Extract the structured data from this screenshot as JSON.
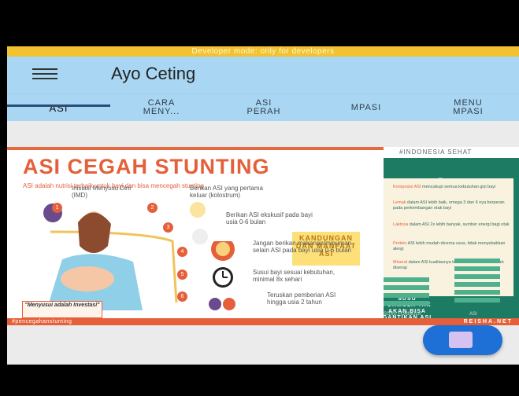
{
  "dev_banner": "Developer mode: only for developers",
  "app": {
    "title": "Ayo Ceting",
    "menu_icon": "hamburger-icon"
  },
  "tabs": [
    {
      "label": "ASI",
      "active": true
    },
    {
      "label": "CARA MENY...",
      "active": false
    },
    {
      "label": "ASI PERAH",
      "active": false
    },
    {
      "label": "MPASI",
      "active": false
    },
    {
      "label": "MENU MPASI",
      "active": false
    }
  ],
  "poster": {
    "headline": "ASI CEGAH STUNTING",
    "subhead": "ASI adalah nutrisi terbaik untuk bayi dan bisa mencegah stunting",
    "hashtag_top": "#INDONESIA SEHAT",
    "kandungan": "KANDUNGAN DAN MANFAAT ASI",
    "steps": [
      "Inisiasi Menyusu Dini (IMD)",
      "Berikan ASI yang pertama keluar (kolostrum)",
      "Berikan ASI ekskusif pada bayi usia 0-6 bulan",
      "Jangan berikan makanan/minuman selain ASI pada bayi usia 0-6 bulan",
      "Susui bayi sesuai kebutuhan, minimal 8x sehari",
      "Teruskan pemberian ASI hingga usia 2 tahun"
    ],
    "tips": [
      {
        "key": "Komposisi ASI",
        "text": " mencukupi semua kebutuhan gizi bayi"
      },
      {
        "key": "Lemak",
        "text": " dalam ASI lebih baik, omega 3 dan 6 nya berperan pada perkembangan otak bayi"
      },
      {
        "key": "Laktosa",
        "text": " dalam ASI 2x lebih banyak, sumber energi bagi otak"
      },
      {
        "key": "Protein",
        "text": " ASI lebih mudah dicerna usus, tidak menyebabkan alergi"
      },
      {
        "key": "Mineral",
        "text": " dalam ASI kualitasnya lebih baik dan lebih mudah diserap"
      }
    ],
    "susu": "SUSU FORMULA TAK AKAN BISA GANTIKAN ASI",
    "col_left": "SUSU FORMULA",
    "col_right": "ASI",
    "quote": "\"Menyusui adalah Investasi\"",
    "hashtag_bottom": "#pencegahanstunting",
    "credit": "REISHA.NET"
  },
  "colors": {
    "accent": "#e5603a",
    "appbar": "#a9d7f3",
    "dev": "#f2c230",
    "green": "#1e7b63",
    "fab": "#1e6fd6"
  }
}
